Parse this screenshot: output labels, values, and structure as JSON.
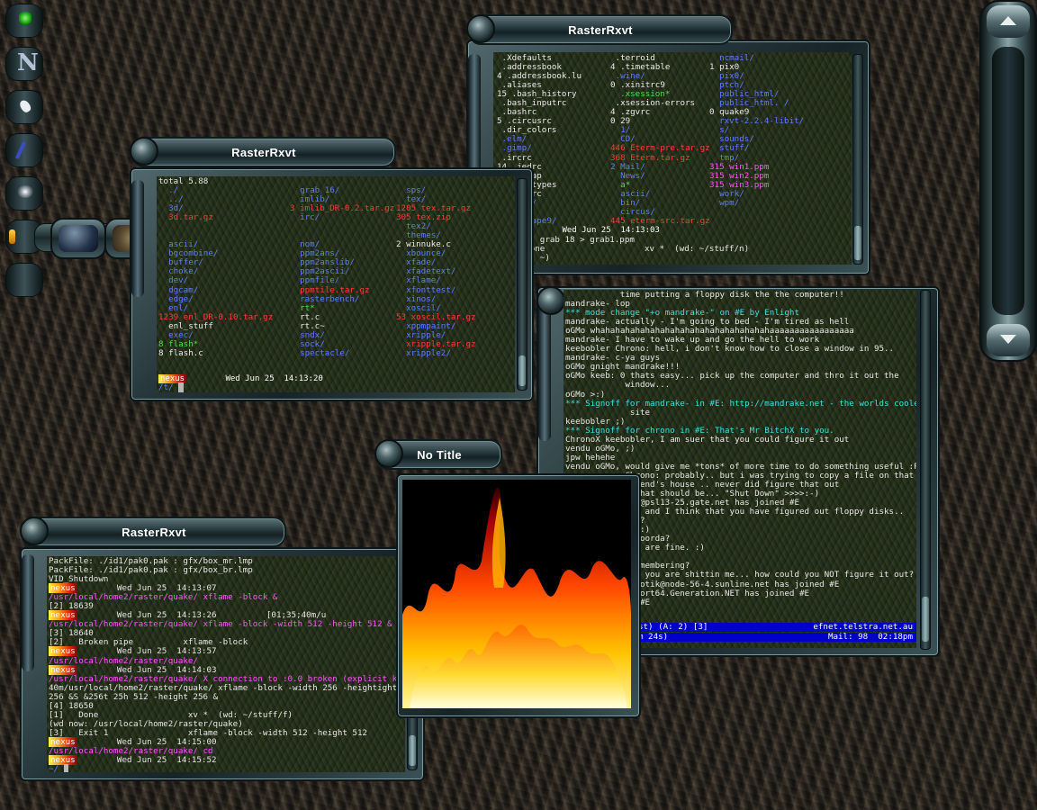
{
  "windows": {
    "tl_title": "RasterRxvt",
    "tr_title": "RasterRxvt",
    "bl_title": "RasterRxvt",
    "fire_title": "No Title"
  },
  "dock": {
    "letter": "N"
  },
  "tr_term": {
    "col1": [
      " .Xdefaults",
      " .addressbook",
      "4 .addressbook.lu",
      " .aliases",
      "15 .bash_history",
      " .bash_inputrc",
      " .bashrc",
      "5 .circusrc",
      " .dir_colors",
      " .elm/",
      " .gimp/",
      " .ircrc",
      "14 .jedrc",
      " .mailcap",
      " .mime.types",
      "6 .muttrc",
      " .ncftp/",
      " .netrc",
      " .netscape9/"
    ],
    "col2": [
      " .terroid",
      "4 .timetable",
      " .wine/",
      "0 .xinitrc9",
      "  .xsession*",
      " .xsession-errors",
      "4 .zgvrc",
      "0 29",
      "  1/",
      "  CD/",
      "446 Eterm-pre.tar.gz",
      "368 Eterm.tar.gz",
      "2 Mail/",
      "  News/",
      "  a*",
      "  ascii/",
      "  bin/",
      "  circus/",
      "445 eterm-src.tar.gz"
    ],
    "col3": [
      "  ncmail/",
      "1 pix0",
      "  pix0/",
      "  ptch/",
      "  public_html/",
      "  public_html. /",
      "0 quake9",
      "  rxvt-2.2.4-libit/",
      "  s/",
      "  sounds/",
      "  stuff/",
      "  tmp/",
      "315 win1.ppm",
      "315 win2.ppm",
      "315 win3.ppm",
      "  work/",
      "  wpm/",
      "",
      ""
    ],
    "status_tag": "nexus",
    "status_date": "Wed Jun 25  14:13:03",
    "line1": "sleep 5; grab 18 > grab1.ppm",
    "line2": "[1]+  Done                    xv *  (wd: ~/stuff/n)",
    "line3": "(wd now: ~)"
  },
  "tl_term": {
    "header": "total 5.88",
    "col1": [
      "  ./",
      "  ../",
      "  3d/",
      "  3d.tar.gz",
      "",
      "",
      "  ascii/",
      "  bgcombine/",
      "  buffer/",
      "  choke/",
      "  dev/",
      "  dgcam/",
      "  edge/",
      "  enl/",
      "1239 enl_DR-0.10.tar.gz",
      "  enl_stuff",
      "  exec/",
      "8 flash*",
      "8 flash.c"
    ],
    "col2": [
      "  grab 16/",
      "  imlib/",
      "3 imlib_DR-0.2.tar.gz",
      "  irc/",
      "",
      "",
      "  nom/",
      "  ppm2ans/",
      "  ppm2anslib/",
      "  ppm2ascii/",
      "  ppmfile/",
      "  ppmtile.tar.gz",
      "  rasterbench/",
      "  rt*",
      "  rt.c",
      "  rt.c~",
      "  sndx/",
      "  sock/",
      "  spectacle/"
    ],
    "col3": [
      "  sps/",
      "  tex/",
      "1205 tex.tar.gz",
      "305 tex.zip",
      "  tex2/",
      "  themes/",
      "2 winnuke.c",
      "  xbounce/",
      "  xfade/",
      "  xfadetext/",
      "  xflame/",
      "  xfonttest/",
      "  xinos/",
      "  xoscil/",
      "53 xoscil.tar.gz",
      "  xppmpaint/",
      "  xripple/",
      "  xripple.tar.gz",
      "  xripple2/"
    ],
    "status_tag": "nexus",
    "status_date": "Wed Jun 25  14:13:20",
    "prompt": "/t/"
  },
  "irc": {
    "lines": [
      "           time putting a floppy disk the the computer!!",
      "mandrake- lop",
      "*** mode change \"+o mandrake-\" on #E by Enlight",
      "mandrake- actually - I'm going to bed - I'm tired as hell",
      "oGMo whahahahahahahahahahahahahahahahahahaaaaaaaaaaaaaaaaa",
      "mandrake- I have to wake up and go the hell to work",
      "keebobler Chrono: hell, i don't know how to close a window in 95..",
      "mandrake- c-ya guys",
      "oGMo gnight mandrake!!!",
      "oGMo keeb: 0 thats easy... pick up the computer and thro it out the",
      "            window...",
      "oGMo >:)",
      "*** Signoff for mandrake- in #E: http://mandrake.net - the worlds coolest web",
      "             site",
      "keebobler ;)",
      "*** Signoff for chrono in #E: That's Mr BitchX to you.",
      "ChronoX keebobler, I am suer that you could figure it out",
      "vendu oGMo, ;)",
      "jpw hehehe",
      "vendu oGMo, would give me *tons* of more time to do something useful :P",
      "            Chrono: probably.. but i was trying to copy a file on that thing",
      "            friend's house .. never did figure that out",
      "            e that should be... \"Shut Down\" >>>>:-)",
      "            ran@psl13-25.gate.net has joined #E",
      "            er, and I think that you have figured out floppy disks..",
      "            you?",
      "            ll :)",
      "            t Noorda?",
      "            ies are fine. :)",
      "",
      "            dismembering?",
      "            er, you are shittin me... how could you NOT figure it out?",
      "            mpnotik@node-56-4.sunline.net has joined #E",
      "            99port64.Generation.NET has joined #E",
      "            ft #E"
    ],
    "status1_left": "fksw) on #E (+nst) (A: 2) [3]",
    "status1_right": "efnet.telstra.net.au",
    "status2_left": "2  (up 0d 1h 14m 24s)",
    "status2_right": "Mail: 98  02:18pm"
  },
  "bl_term": {
    "lines": [
      "PackFile: ./id1/pak0.pak : gfx/box_mr.lmp",
      "PackFile: ./id1/pak0.pak : gfx/box_br.lmp",
      "VID_Shutdown",
      "",
      "/usr/local/home2/raster/quake/ xflame -block &",
      "[2] 18639",
      "",
      "/usr/local/home2/raster/quake/ xflame -block -width 512 -height 512 &",
      "[3] 18640",
      "[2]   Broken pipe          xflame -block",
      "",
      "/usr/local/home2/raster/quake/",
      "",
      "/usr/local/home2/raster/quake/ X connection to :0.0 broken (explicit kill o",
      "40m/usr/local/home2/raster/quake/ xflame -block -width 256 -heightight 256",
      "256 &S &256t 25h 512 -height 256 &",
      "[4] 18650",
      "[1]   Done                  xv *  (wd: ~/stuff/f)",
      "(wd now: /usr/local/home2/raster/quake)",
      "[3]   Exit 1                xflame -block -width 512 -height 512",
      "",
      "/usr/local/home2/raster/quake/ cd",
      ""
    ],
    "statuses": [
      {
        "tag": "nexus",
        "date": "Wed Jun 25  14:13:07",
        "extra": ""
      },
      {
        "tag": "nexus",
        "date": "Wed Jun 25  14:13:26",
        "extra": "[01;35;40m/u"
      },
      {
        "tag": "nexus",
        "date": "Wed Jun 25  14:13:57",
        "extra": ""
      },
      {
        "tag": "nexus",
        "date": "Wed Jun 25  14:14:03",
        "extra": ""
      },
      {
        "tag": "nexus",
        "date": "Wed Jun 25  14:15:00",
        "extra": ""
      },
      {
        "tag": "nexus",
        "date": "Wed Jun 25  14:15:52",
        "extra": ""
      }
    ],
    "prompt": "~/"
  }
}
